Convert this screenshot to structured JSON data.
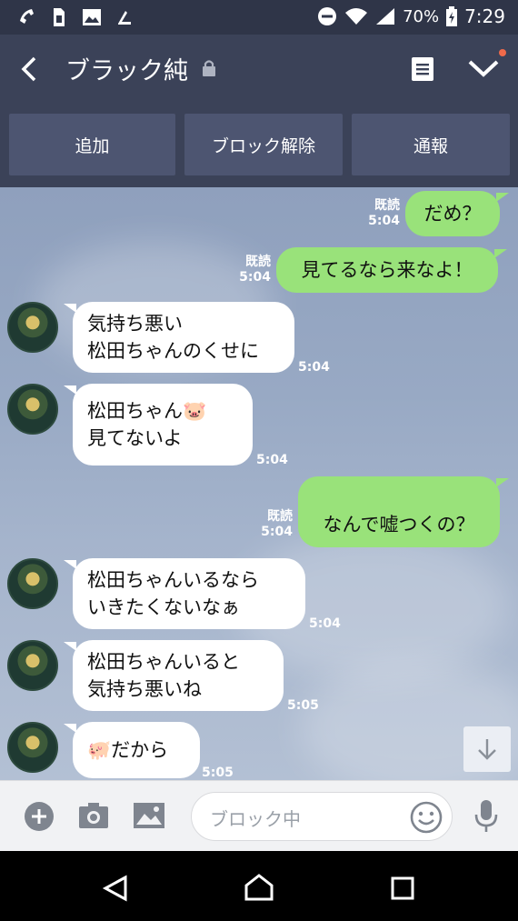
{
  "status_bar": {
    "battery": "70%",
    "time": "7:29"
  },
  "header": {
    "title": "ブラック純"
  },
  "actions": [
    {
      "label": "追加"
    },
    {
      "label": "ブロック解除"
    },
    {
      "label": "通報"
    }
  ],
  "messages": [
    {
      "from": "me",
      "text": "だめ？",
      "read": "既読",
      "time": "5:04"
    },
    {
      "from": "me",
      "text": "見てるなら来なよ！",
      "read": "既読",
      "time": "5:04"
    },
    {
      "from": "them",
      "lines": [
        "気持ち悪い",
        "松田ちゃんのくせに"
      ],
      "time": "5:04"
    },
    {
      "from": "them",
      "lines": [
        "松田ちゃん",
        "見てないよ"
      ],
      "emoji": "🐷",
      "time": "5:04"
    },
    {
      "from": "me",
      "text": "なんで嘘つくの？",
      "read": "既読",
      "time": "5:04"
    },
    {
      "from": "them",
      "lines": [
        "松田ちゃんいるなら",
        "いきたくないなぁ"
      ],
      "time": "5:04"
    },
    {
      "from": "them",
      "lines": [
        "松田ちゃんいると",
        "気持ち悪いね"
      ],
      "time": "5:05"
    },
    {
      "from": "them",
      "lines": [
        "だから"
      ],
      "emoji": "🐖",
      "time": "5:05"
    }
  ],
  "input": {
    "placeholder": "ブロック中"
  },
  "icons": [
    "wifi-calling-icon",
    "sim-icon",
    "image-icon",
    "nfc-icon",
    "dnd-icon",
    "wifi-icon",
    "signal-icon",
    "battery-icon",
    "back-icon",
    "lock-icon",
    "memo-icon",
    "chevron-down-icon",
    "plus-icon",
    "camera-icon",
    "gallery-icon",
    "emoji-icon",
    "mic-icon",
    "nav-back-icon",
    "nav-home-icon",
    "nav-recents-icon",
    "scroll-down-icon"
  ],
  "colors": {
    "header": "#3b4258",
    "bubble_me": "#99e27a",
    "bubble_them": "#ffffff",
    "notification_dot": "#f06a4a"
  }
}
